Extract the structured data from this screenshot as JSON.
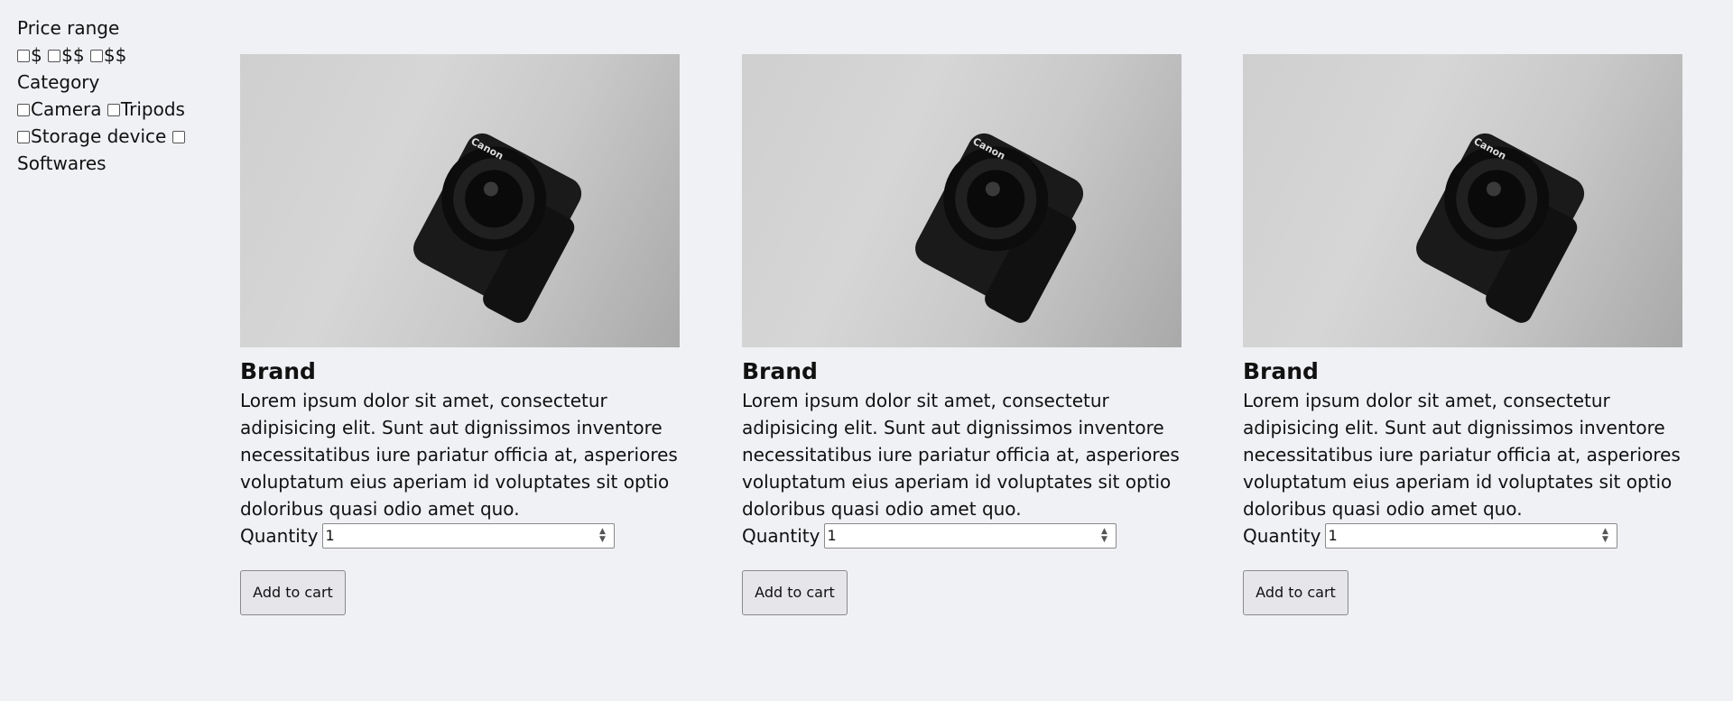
{
  "filters": {
    "price_heading": "Price range",
    "price_options": [
      "$",
      "$$",
      "$$"
    ],
    "category_heading": "Category",
    "category_options": [
      "Camera",
      "Tripods",
      "Storage device",
      "Softwares"
    ]
  },
  "products": [
    {
      "image_icon": "camera-photo",
      "brand": "Brand",
      "description": "Lorem ipsum dolor sit amet, consectetur adipisicing elit. Sunt aut dignissimos inventore necessitatibus iure pariatur officia at, asperiores voluptatum eius aperiam id voluptates sit optio doloribus quasi odio amet quo.",
      "quantity_label": "Quantity",
      "quantity_value": "1",
      "add_label": "Add to cart"
    },
    {
      "image_icon": "camera-photo",
      "brand": "Brand",
      "description": "Lorem ipsum dolor sit amet, consectetur adipisicing elit. Sunt aut dignissimos inventore necessitatibus iure pariatur officia at, asperiores voluptatum eius aperiam id voluptates sit optio doloribus quasi odio amet quo.",
      "quantity_label": "Quantity",
      "quantity_value": "1",
      "add_label": "Add to cart"
    },
    {
      "image_icon": "camera-photo",
      "brand": "Brand",
      "description": "Lorem ipsum dolor sit amet, consectetur adipisicing elit. Sunt aut dignissimos inventore necessitatibus iure pariatur officia at, asperiores voluptatum eius aperiam id voluptates sit optio doloribus quasi odio amet quo.",
      "quantity_label": "Quantity",
      "quantity_value": "1",
      "add_label": "Add to cart"
    }
  ],
  "camera_logo": "Canon"
}
